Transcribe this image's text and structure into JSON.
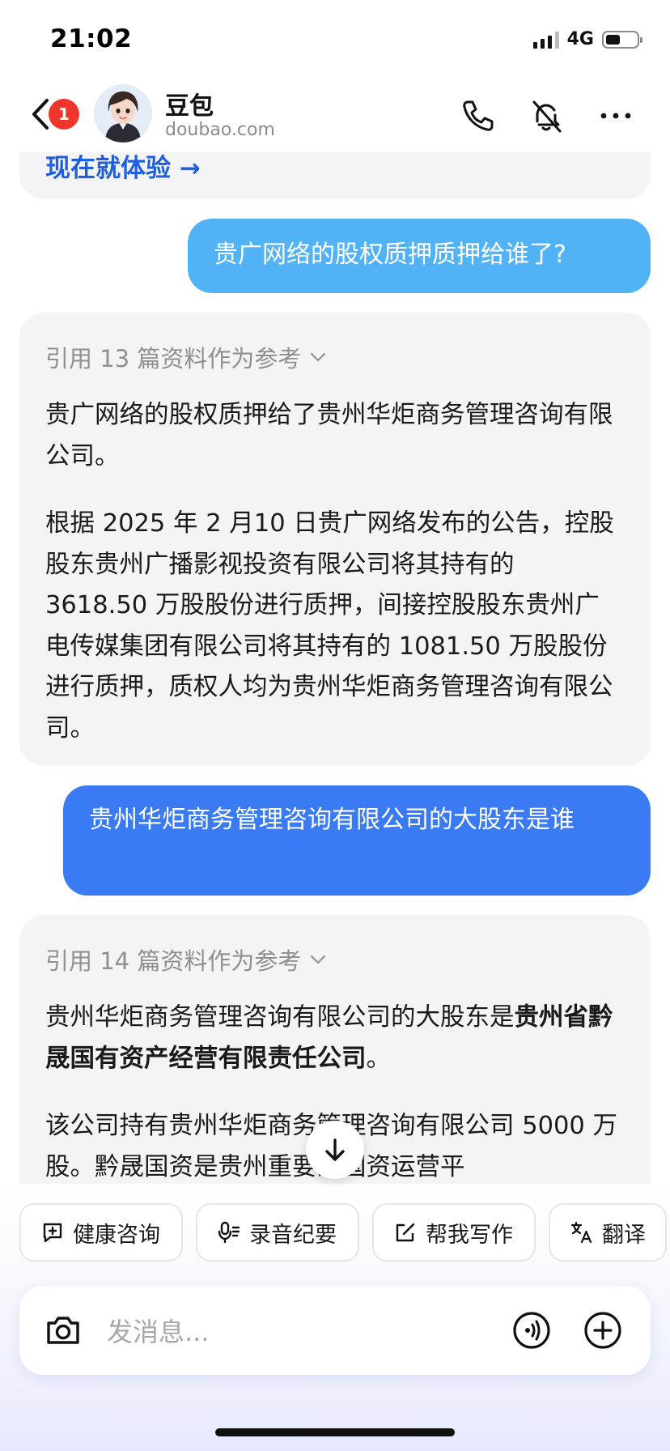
{
  "status": {
    "time": "21:02",
    "network": "4G"
  },
  "header": {
    "back_badge": "1",
    "name": "豆包",
    "subtitle": "doubao.com"
  },
  "top_partial": {
    "cta": "现在就体验 →"
  },
  "messages": {
    "user1": "贵广网络的股权质押质押给谁了?",
    "ai1": {
      "ref": "引用 13 篇资料作为参考",
      "p1": "贵广网络的股权质押给了贵州华炬商务管理咨询有限公司。",
      "p2": "根据 2025 年 2 月10 日贵广网络发布的公告，控股股东贵州广播影视投资有限公司将其持有的 3618.50 万股股份进行质押，间接控股股东贵州广电传媒集团有限公司将其持有的 1081.50 万股股份进行质押，质权人均为贵州华炬商务管理咨询有限公司。"
    },
    "user2": "贵州华炬商务管理咨询有限公司的大股东是谁",
    "ai2": {
      "ref": "引用 14 篇资料作为参考",
      "p1_prefix": "贵州华炬商务管理咨询有限公司的大股东是",
      "p1_bold": "贵州省黔晟国有资产经营有限责任公司",
      "p1_suffix": "。",
      "p2": "该公司持有贵州华炬商务管理咨询有限公司 5000 万股。黔晟国资是贵州重要的国资运营平"
    }
  },
  "chips": [
    {
      "label": "健康咨询",
      "icon": "health-chat-icon"
    },
    {
      "label": "录音纪要",
      "icon": "microphone-icon"
    },
    {
      "label": "帮我写作",
      "icon": "edit-icon"
    },
    {
      "label": "翻译",
      "icon": "translate-icon"
    }
  ],
  "input": {
    "placeholder": "发消息..."
  },
  "colors": {
    "user_light": "#52b2f6",
    "user_dark": "#3a7af2",
    "accent": "#1f5fe0",
    "badge": "#f0352c"
  }
}
